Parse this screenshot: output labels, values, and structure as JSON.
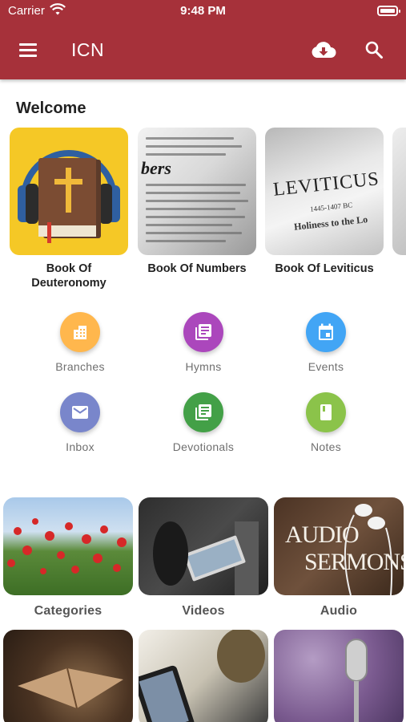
{
  "status": {
    "carrier": "Carrier",
    "time": "9:48 PM"
  },
  "appbar": {
    "title": "ICN",
    "icons": [
      "menu-icon",
      "cloud-download-icon",
      "search-icon"
    ]
  },
  "welcome": {
    "title": "Welcome"
  },
  "books": [
    {
      "label": "Book Of Deuteronomy"
    },
    {
      "label": "Book Of Numbers"
    },
    {
      "label": "Book Of Leviticus"
    }
  ],
  "book_images": {
    "numbers_text": "bers",
    "leviticus_text": "LEVITICUS",
    "leviticus_dates": "1445-1407 BC",
    "leviticus_subtitle": "Holiness to the Lo"
  },
  "actions": [
    {
      "label": "Branches",
      "color": "#ffb74d",
      "icon": "building-icon"
    },
    {
      "label": "Hymns",
      "color": "#ab47bc",
      "icon": "library-books-icon"
    },
    {
      "label": "Events",
      "color": "#42a5f5",
      "icon": "calendar-icon"
    },
    {
      "label": "Inbox",
      "color": "#7986cb",
      "icon": "mail-icon"
    },
    {
      "label": "Devotionals",
      "color": "#43a047",
      "icon": "library-books-icon"
    },
    {
      "label": "Notes",
      "color": "#8bc34a",
      "icon": "book-icon"
    }
  ],
  "media": [
    {
      "label": "Categories"
    },
    {
      "label": "Videos"
    },
    {
      "label": "Audio"
    }
  ],
  "audio_image": {
    "line1": "AUDIO",
    "line2": "SERMONS"
  },
  "colors": {
    "appbar": "#a6313a"
  }
}
